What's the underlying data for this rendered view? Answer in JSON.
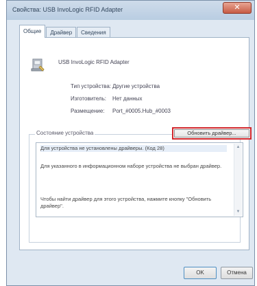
{
  "window": {
    "title": "Свойства: USB InvoLogic RFID Adapter",
    "close_symbol": "✕"
  },
  "tabs": [
    {
      "label": "Общие",
      "active": true
    },
    {
      "label": "Драйвер",
      "active": false
    },
    {
      "label": "Сведения",
      "active": false
    }
  ],
  "device": {
    "icon": "usb-device-icon",
    "name": "USB InvoLogic RFID Adapter",
    "props": [
      {
        "label": "Тип устройства:",
        "value": "Другие устройства"
      },
      {
        "label": "Изготовитель:",
        "value": "Нет данных"
      },
      {
        "label": "Размещение:",
        "value": "Port_#0005.Hub_#0003"
      }
    ]
  },
  "status": {
    "group_label": "Состояние устройства",
    "line1": "Для устройства не установлены драйверы. (Код 28)",
    "line2": "Для указанного в информационном наборе устройства не выбран драйвер.",
    "line3": "Чтобы найти драйвер для этого устройства, нажмите кнопку \"Обновить драйвер\".",
    "update_button": "Обновить драйвер..."
  },
  "footer": {
    "ok": "OK",
    "cancel": "Отмена"
  }
}
